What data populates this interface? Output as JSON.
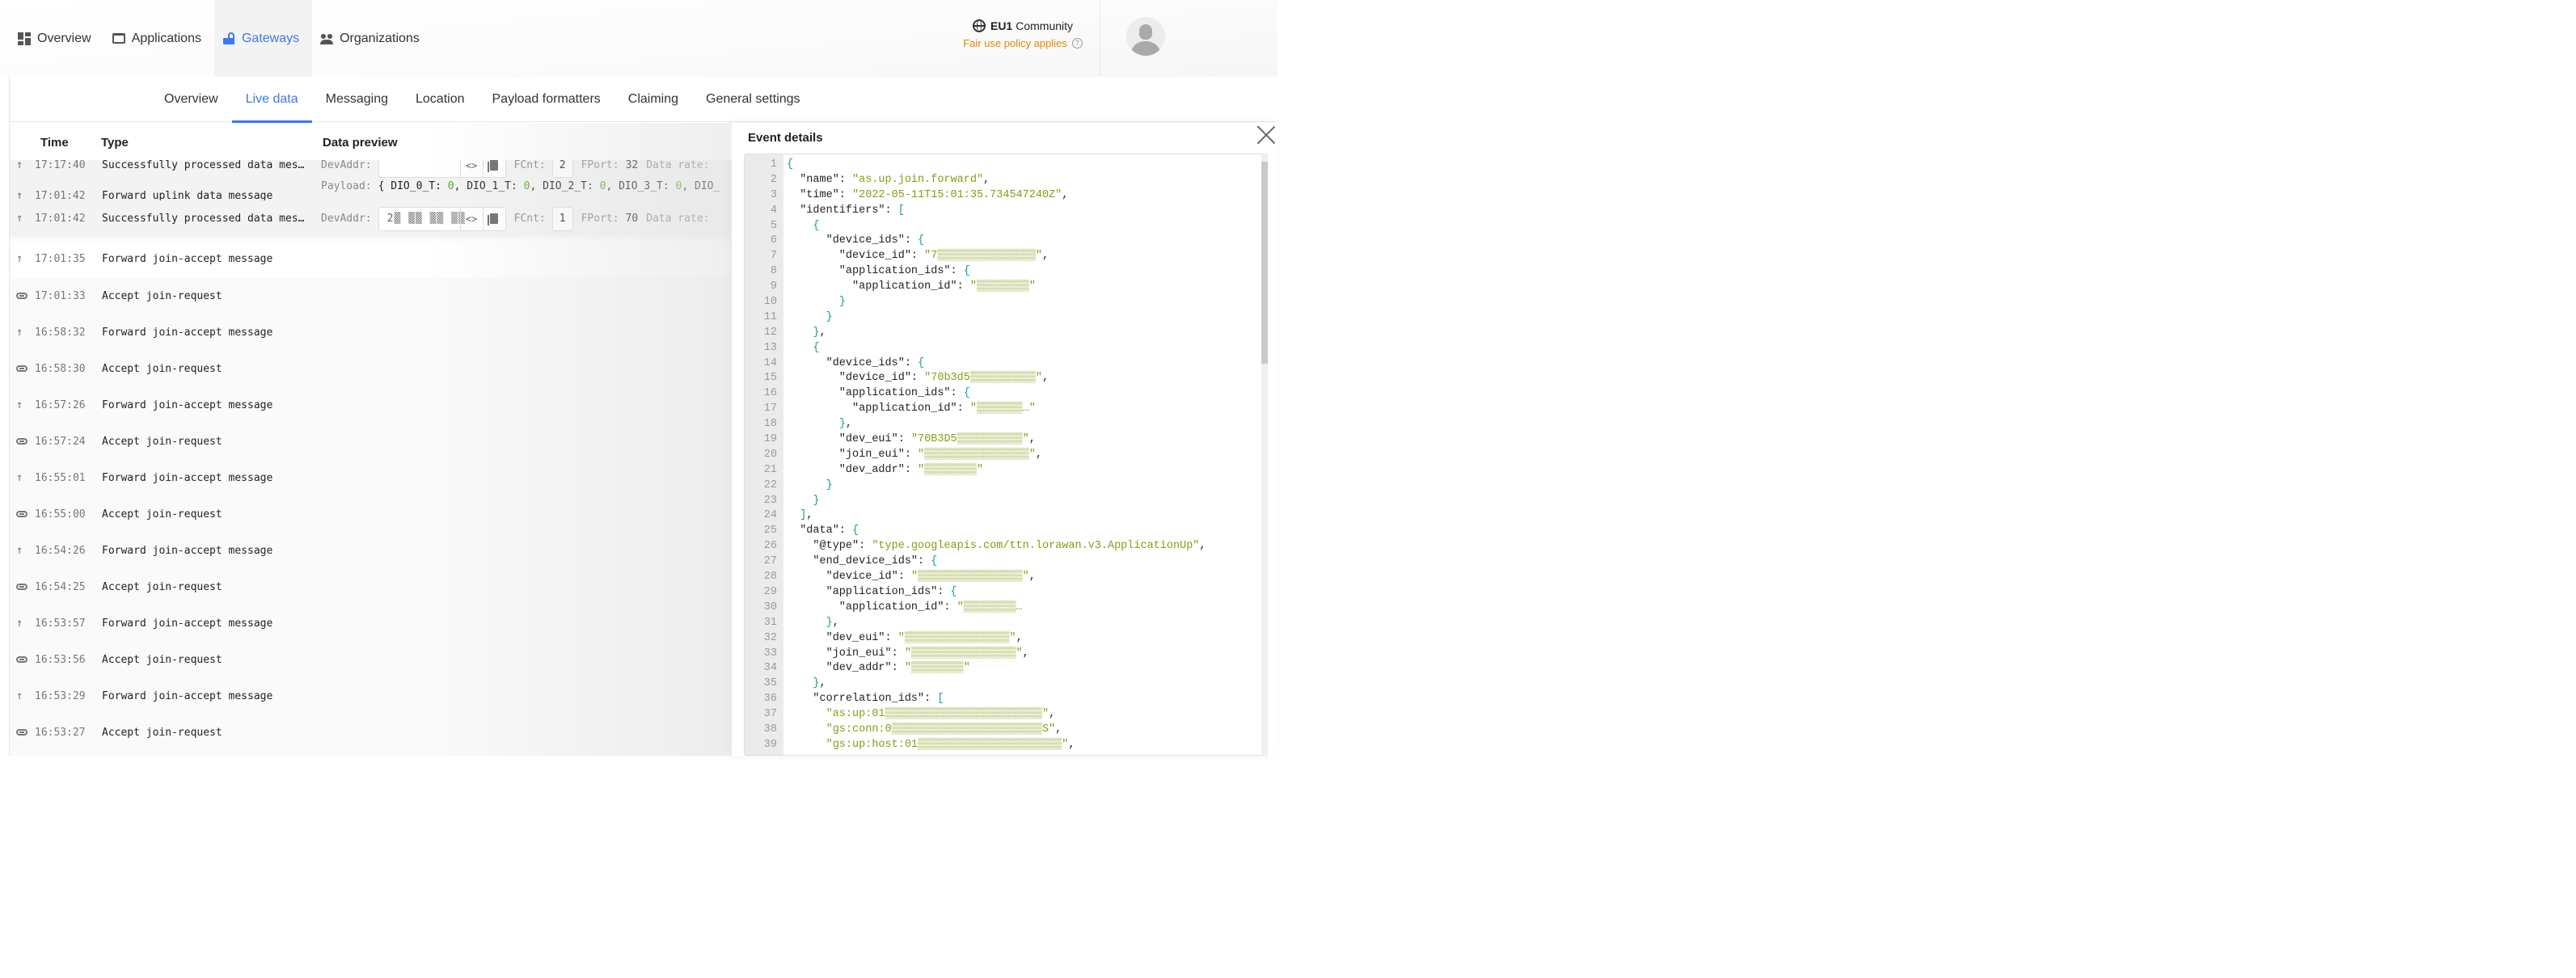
{
  "header": {
    "nav": [
      {
        "label": "Overview",
        "icon": "dashboard-icon",
        "active": false
      },
      {
        "label": "Applications",
        "icon": "application-icon",
        "active": false
      },
      {
        "label": "Gateways",
        "icon": "gateway-icon",
        "active": true
      },
      {
        "label": "Organizations",
        "icon": "organization-icon",
        "active": false
      }
    ],
    "region": {
      "code": "EU1",
      "name": "Community",
      "icon": "globe-icon"
    },
    "fair_use": "Fair use policy applies",
    "avatar_icon": "user-avatar-icon"
  },
  "tabs": [
    {
      "label": "Overview",
      "active": false
    },
    {
      "label": "Live data",
      "active": true
    },
    {
      "label": "Messaging",
      "active": false
    },
    {
      "label": "Location",
      "active": false
    },
    {
      "label": "Payload formatters",
      "active": false
    },
    {
      "label": "Claiming",
      "active": false
    },
    {
      "label": "General settings",
      "active": false
    }
  ],
  "table": {
    "columns": {
      "time": "Time",
      "type": "Type",
      "preview": "Data preview"
    },
    "rows": [
      {
        "icon": "uplink-arrow-icon",
        "time": "17:17:40",
        "type": "Successfully processed data mes…",
        "preview": {
          "devaddr_label": "DevAddr:",
          "devaddr": "",
          "fcnt_label": "FCnt:",
          "fcnt": "2",
          "fport_label": "FPort:",
          "fport": "32",
          "datarate_label": "Data rate:"
        }
      },
      {
        "icon": "uplink-arrow-icon",
        "time": "17:01:42",
        "type": "Forward uplink data message",
        "payload": {
          "label": "Payload:",
          "open": "{",
          "fields": [
            {
              "key": "DIO_0_T",
              "value": "0"
            },
            {
              "key": "DIO_1_T",
              "value": "0"
            },
            {
              "key": "DIO_2_T",
              "value": "0"
            },
            {
              "key": "DIO_3_T",
              "value": "0"
            }
          ],
          "trailing": "DIO_"
        }
      },
      {
        "icon": "uplink-arrow-icon",
        "time": "17:01:42",
        "type": "Successfully processed data mes…",
        "preview": {
          "devaddr_label": "DevAddr:",
          "devaddr": "2▒ ▒▒ ▒▒ ▒▒",
          "fcnt_label": "FCnt:",
          "fcnt": "1",
          "fport_label": "FPort:",
          "fport": "70",
          "datarate_label": "Data rate:"
        }
      },
      {
        "icon": "uplink-arrow-icon",
        "time": "17:01:35",
        "type": "Forward join-accept message"
      },
      {
        "icon": "link-icon",
        "time": "17:01:33",
        "type": "Accept join-request"
      },
      {
        "icon": "uplink-arrow-icon",
        "time": "16:58:32",
        "type": "Forward join-accept message"
      },
      {
        "icon": "link-icon",
        "time": "16:58:30",
        "type": "Accept join-request"
      },
      {
        "icon": "uplink-arrow-icon",
        "time": "16:57:26",
        "type": "Forward join-accept message"
      },
      {
        "icon": "link-icon",
        "time": "16:57:24",
        "type": "Accept join-request"
      },
      {
        "icon": "uplink-arrow-icon",
        "time": "16:55:01",
        "type": "Forward join-accept message"
      },
      {
        "icon": "link-icon",
        "time": "16:55:00",
        "type": "Accept join-request"
      },
      {
        "icon": "uplink-arrow-icon",
        "time": "16:54:26",
        "type": "Forward join-accept message"
      },
      {
        "icon": "link-icon",
        "time": "16:54:25",
        "type": "Accept join-request"
      },
      {
        "icon": "uplink-arrow-icon",
        "time": "16:53:57",
        "type": "Forward join-accept message"
      },
      {
        "icon": "link-icon",
        "time": "16:53:56",
        "type": "Accept join-request"
      },
      {
        "icon": "uplink-arrow-icon",
        "time": "16:53:29",
        "type": "Forward join-accept message"
      },
      {
        "icon": "link-icon",
        "time": "16:53:27",
        "type": "Accept join-request"
      }
    ]
  },
  "event_details": {
    "title": "Event details",
    "close_icon": "close-icon",
    "code_lines": [
      [
        [
          "b",
          "{"
        ]
      ],
      [
        [
          "k",
          "  \"name\": "
        ],
        [
          "s",
          "\"as.up.join.forward\""
        ],
        [
          "p",
          ","
        ]
      ],
      [
        [
          "k",
          "  \"time\": "
        ],
        [
          "s",
          "\"2022-05-11T15:01:35.734547240Z\""
        ],
        [
          "p",
          ","
        ]
      ],
      [
        [
          "k",
          "  \"identifiers\": "
        ],
        [
          "b",
          "["
        ]
      ],
      [
        [
          "p",
          "    "
        ],
        [
          "b",
          "{"
        ]
      ],
      [
        [
          "k",
          "      \"device_ids\": "
        ],
        [
          "b",
          "{"
        ]
      ],
      [
        [
          "k",
          "        \"device_id\": "
        ],
        [
          "s",
          "\"7▒▒▒▒▒▒▒▒▒▒▒▒▒▒▒\""
        ],
        [
          "p",
          ","
        ]
      ],
      [
        [
          "k",
          "        \"application_ids\": "
        ],
        [
          "b",
          "{"
        ]
      ],
      [
        [
          "k",
          "          \"application_id\": "
        ],
        [
          "s",
          "\"▒▒▒▒▒▒▒▒\""
        ]
      ],
      [
        [
          "p",
          "        "
        ],
        [
          "b",
          "}"
        ]
      ],
      [
        [
          "p",
          "      "
        ],
        [
          "b",
          "}"
        ]
      ],
      [
        [
          "p",
          "    "
        ],
        [
          "b",
          "}"
        ],
        [
          "p",
          ","
        ]
      ],
      [
        [
          "p",
          "    "
        ],
        [
          "b",
          "{"
        ]
      ],
      [
        [
          "k",
          "      \"device_ids\": "
        ],
        [
          "b",
          "{"
        ]
      ],
      [
        [
          "k",
          "        \"device_id\": "
        ],
        [
          "s",
          "\"70b3d5▒▒▒▒▒▒▒▒▒▒\""
        ],
        [
          "p",
          ","
        ]
      ],
      [
        [
          "k",
          "        \"application_ids\": "
        ],
        [
          "b",
          "{"
        ]
      ],
      [
        [
          "k",
          "          \"application_id\": "
        ],
        [
          "s",
          "\"▒▒▒▒▒▒▒…\""
        ]
      ],
      [
        [
          "p",
          "        "
        ],
        [
          "b",
          "}"
        ],
        [
          "p",
          ","
        ]
      ],
      [
        [
          "k",
          "        \"dev_eui\": "
        ],
        [
          "s",
          "\"70B3D5▒▒▒▒▒▒▒▒▒▒\""
        ],
        [
          "p",
          ","
        ]
      ],
      [
        [
          "k",
          "        \"join_eui\": "
        ],
        [
          "s",
          "\"▒▒▒▒▒▒▒▒▒▒▒▒▒▒▒▒\""
        ],
        [
          "p",
          ","
        ]
      ],
      [
        [
          "k",
          "        \"dev_addr\": "
        ],
        [
          "s",
          "\"▒▒▒▒▒▒▒▒\""
        ]
      ],
      [
        [
          "p",
          "      "
        ],
        [
          "b",
          "}"
        ]
      ],
      [
        [
          "p",
          "    "
        ],
        [
          "b",
          "}"
        ]
      ],
      [
        [
          "p",
          "  "
        ],
        [
          "b",
          "]"
        ],
        [
          "p",
          ","
        ]
      ],
      [
        [
          "k",
          "  \"data\": "
        ],
        [
          "b",
          "{"
        ]
      ],
      [
        [
          "k",
          "    \"@type\": "
        ],
        [
          "s",
          "\"type.googleapis.com/ttn.lorawan.v3.ApplicationUp\""
        ],
        [
          "p",
          ","
        ]
      ],
      [
        [
          "k",
          "    \"end_device_ids\": "
        ],
        [
          "b",
          "{"
        ]
      ],
      [
        [
          "k",
          "      \"device_id\": "
        ],
        [
          "s",
          "\"▒▒▒▒▒▒▒▒▒▒▒▒▒▒▒▒\""
        ],
        [
          "p",
          ","
        ]
      ],
      [
        [
          "k",
          "      \"application_ids\": "
        ],
        [
          "b",
          "{"
        ]
      ],
      [
        [
          "k",
          "        \"application_id\": "
        ],
        [
          "s",
          "\"▒▒▒▒▒▒▒▒…"
        ]
      ],
      [
        [
          "p",
          "      "
        ],
        [
          "b",
          "}"
        ],
        [
          "p",
          ","
        ]
      ],
      [
        [
          "k",
          "      \"dev_eui\": "
        ],
        [
          "s",
          "\"▒▒▒▒▒▒▒▒▒▒▒▒▒▒▒▒\""
        ],
        [
          "p",
          ","
        ]
      ],
      [
        [
          "k",
          "      \"join_eui\": "
        ],
        [
          "s",
          "\"▒▒▒▒▒▒▒▒▒▒▒▒▒▒▒▒\""
        ],
        [
          "p",
          ","
        ]
      ],
      [
        [
          "k",
          "      \"dev_addr\": "
        ],
        [
          "s",
          "\"▒▒▒▒▒▒▒▒\""
        ]
      ],
      [
        [
          "p",
          "    "
        ],
        [
          "b",
          "}"
        ],
        [
          "p",
          ","
        ]
      ],
      [
        [
          "k",
          "    \"correlation_ids\": "
        ],
        [
          "b",
          "["
        ]
      ],
      [
        [
          "s",
          "      \"as:up:01▒▒▒▒▒▒▒▒▒▒▒▒▒▒▒▒▒▒▒▒▒▒▒▒\""
        ],
        [
          "p",
          ","
        ]
      ],
      [
        [
          "s",
          "      \"gs:conn:0▒▒▒▒▒▒▒▒▒▒▒▒▒▒▒▒▒▒▒▒▒▒▒S\""
        ],
        [
          "p",
          ","
        ]
      ],
      [
        [
          "s",
          "      \"gs:up:host:01▒▒▒▒▒▒▒▒▒▒▒▒▒▒▒▒▒▒▒▒▒▒\""
        ],
        [
          "p",
          ","
        ]
      ]
    ]
  }
}
